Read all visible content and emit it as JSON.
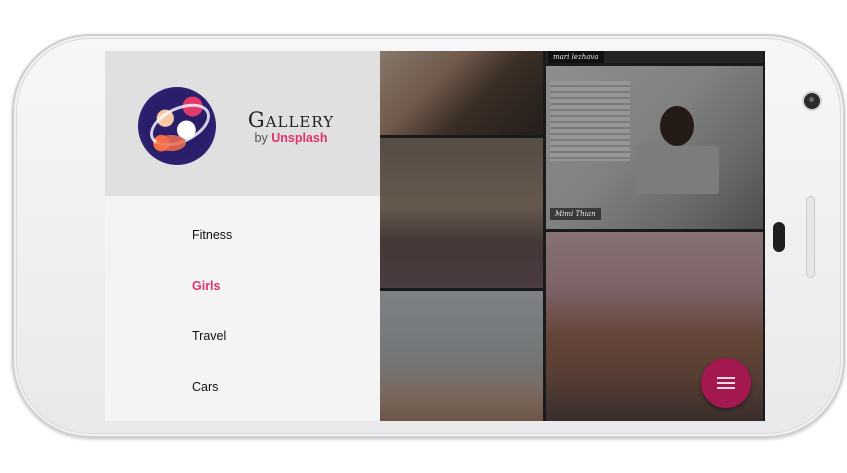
{
  "drawer": {
    "title": "Gallery",
    "by_prefix": "by",
    "by_brand": "Unsplash",
    "menu": [
      {
        "label": "Fitness",
        "active": false
      },
      {
        "label": "Girls",
        "active": true
      },
      {
        "label": "Travel",
        "active": false
      },
      {
        "label": "Cars",
        "active": false
      }
    ]
  },
  "gallery": {
    "captions": [
      "mari lezhava",
      "Mimi Thian"
    ]
  },
  "colors": {
    "accent": "#e0336d",
    "fab": "#a3184f"
  },
  "icons": {
    "fab": "menu-icon"
  }
}
